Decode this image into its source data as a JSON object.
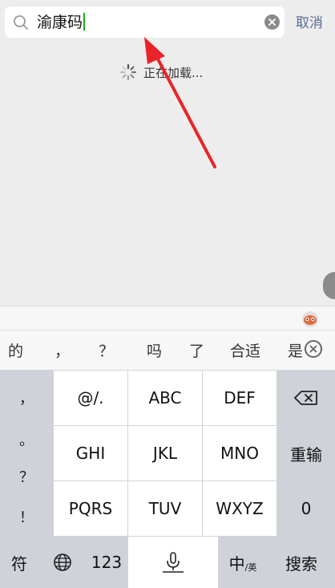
{
  "search": {
    "query": "渝康码",
    "cancel_label": "取消"
  },
  "loading": {
    "text": "正在加载..."
  },
  "candidates": [
    "的",
    "，",
    "？",
    "吗",
    "了",
    "合适",
    "是"
  ],
  "keyboard": {
    "left_symbols": [
      "，",
      "。",
      "？",
      "！"
    ],
    "row1": [
      "@/.",
      "ABC",
      "DEF"
    ],
    "row2": [
      "GHI",
      "JKL",
      "MNO"
    ],
    "row2_action": "重输",
    "row3": [
      "PQRS",
      "TUV",
      "WXYZ"
    ],
    "row3_action": "0",
    "bottom": {
      "symbols": "符",
      "numbers": "123",
      "lang": "中",
      "lang_sub": "/英",
      "search": "搜索"
    }
  },
  "colors": {
    "accent_cancel": "#576b95",
    "caret": "#1aad19",
    "arrow": "#e8242a"
  }
}
